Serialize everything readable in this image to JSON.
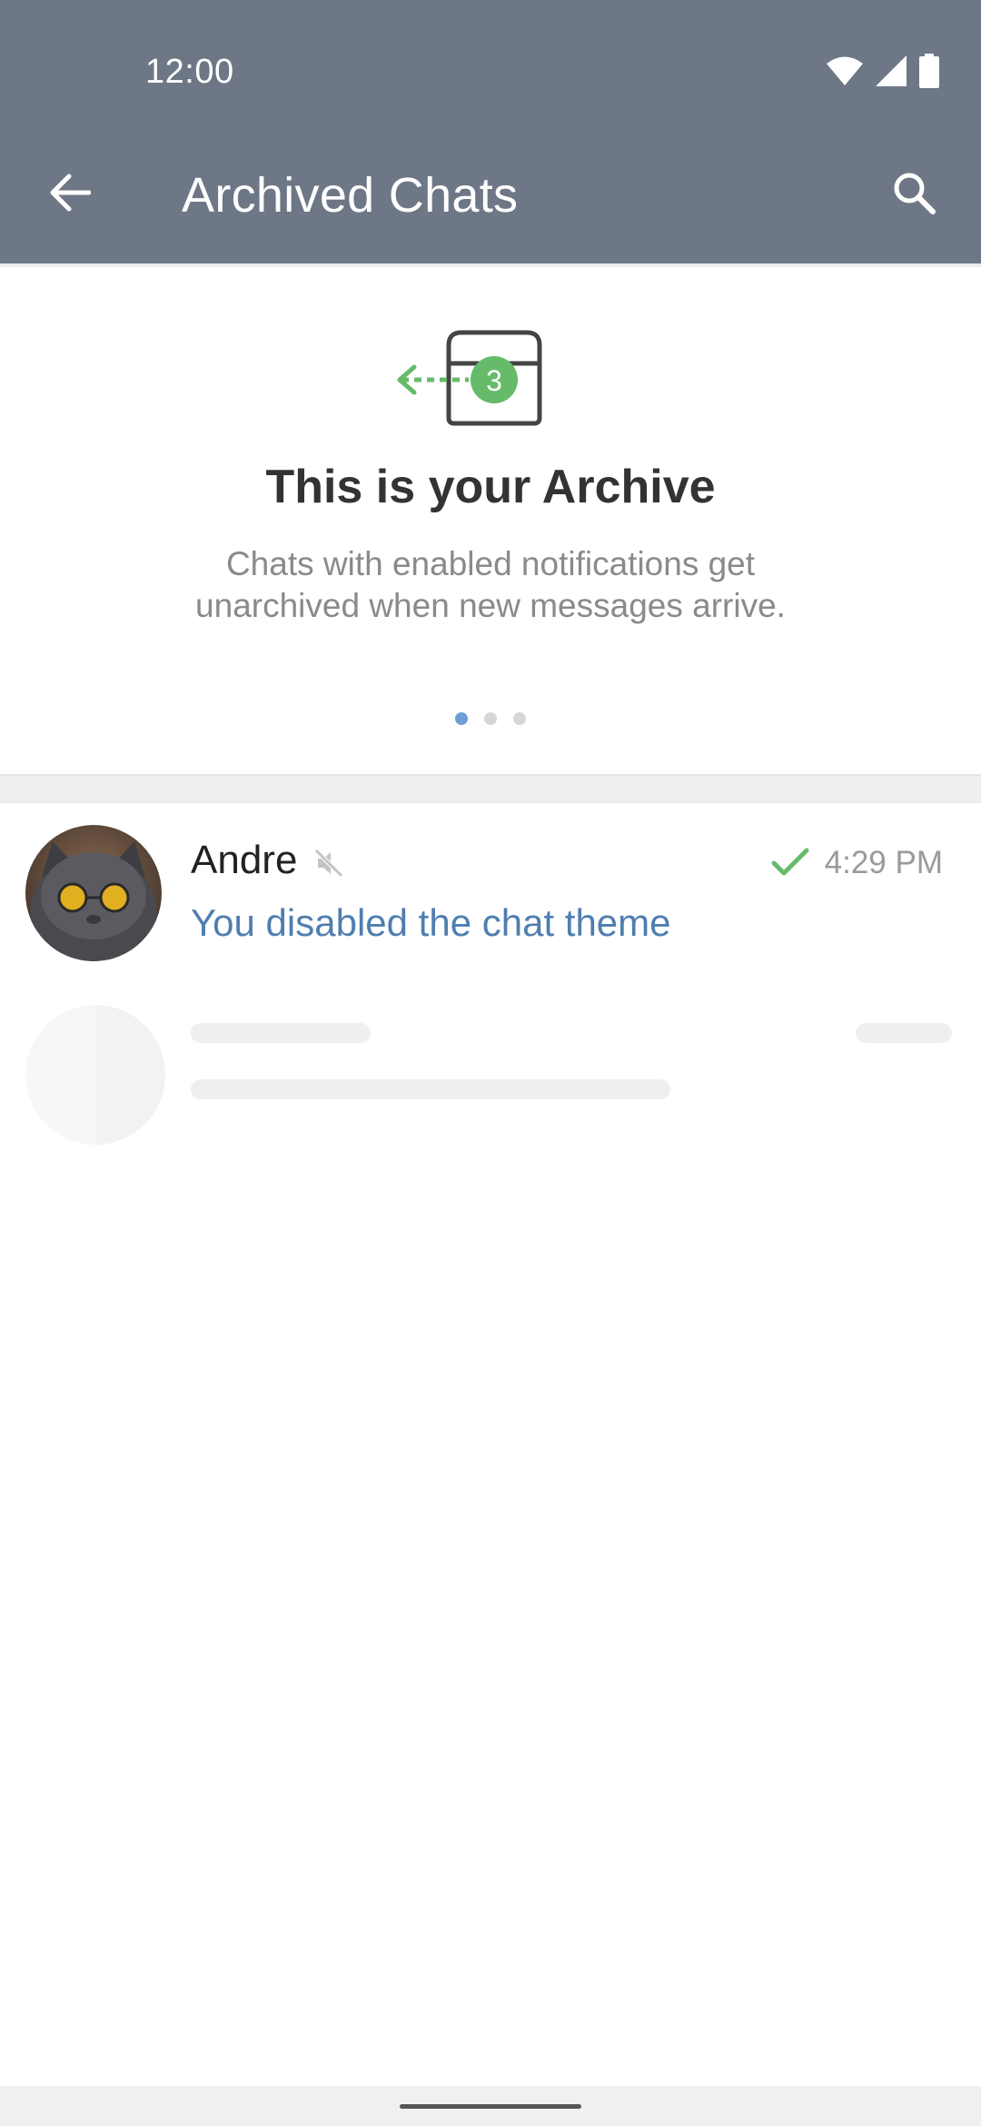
{
  "status_bar": {
    "time": "12:00",
    "icons": [
      "wifi-icon",
      "signal-icon",
      "battery-icon"
    ]
  },
  "header": {
    "title": "Archived Chats",
    "back_icon": "arrow-left-icon",
    "search_icon": "search-icon",
    "background": "#6e7786"
  },
  "archive_intro": {
    "illustration_icon": "archive-box-icon",
    "badge_count": "3",
    "title": "This is your Archive",
    "description_line1": "Chats with enabled notifications get",
    "description_line2": "unarchived when new messages arrive.",
    "pager": {
      "total": 3,
      "active_index": 0
    }
  },
  "chats": [
    {
      "name": "Andre",
      "muted": true,
      "read": true,
      "time": "4:29 PM",
      "preview": "You disabled the chat theme",
      "avatar": "cat-with-sunglasses"
    }
  ],
  "colors": {
    "accent_green": "#66bb6a",
    "link_blue": "#4f7eb0",
    "pager_active": "#6d9ed6"
  }
}
